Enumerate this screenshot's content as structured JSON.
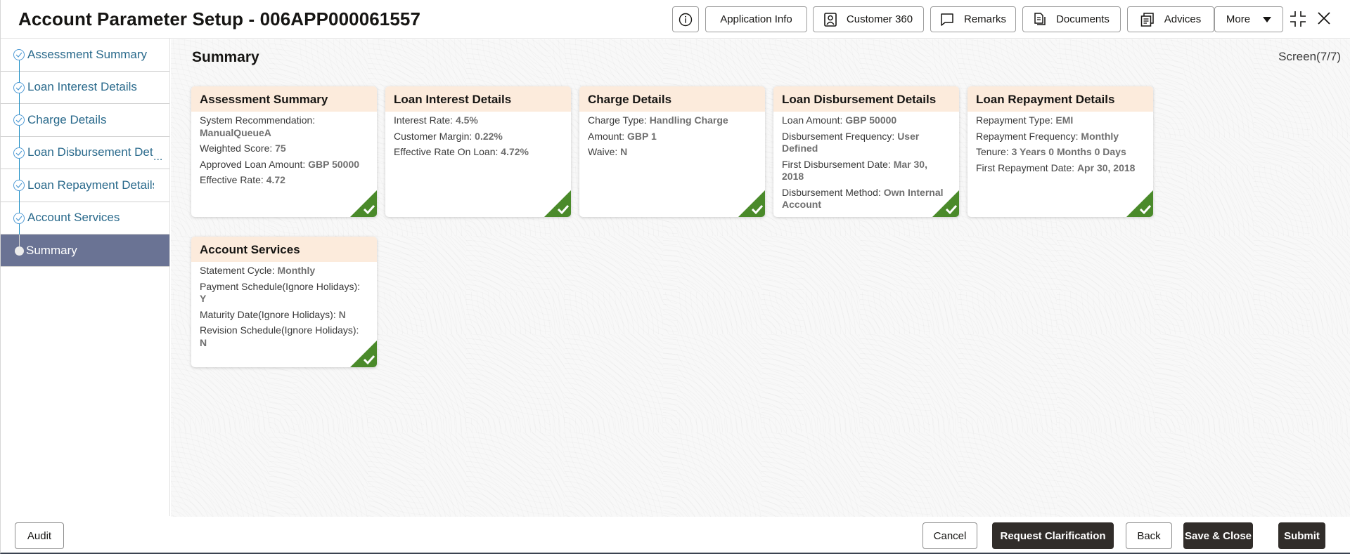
{
  "header": {
    "title": "Account Parameter Setup - 006APP000061557",
    "buttons": {
      "info_icon": "info-icon",
      "application_info": "Application Info",
      "customer_360": "Customer 360",
      "remarks": "Remarks",
      "documents": "Documents",
      "advices": "Advices",
      "more": "More"
    }
  },
  "sidebar": {
    "items": [
      {
        "label": "Assessment Summary",
        "state": "completed"
      },
      {
        "label": "Loan Interest Details",
        "state": "completed"
      },
      {
        "label": "Charge Details",
        "state": "completed"
      },
      {
        "label": "Loan Disbursement Det",
        "state": "completed",
        "truncated_indicator": "..."
      },
      {
        "label": "Loan Repayment Details",
        "state": "completed"
      },
      {
        "label": "Account Services",
        "state": "completed"
      },
      {
        "label": "Summary",
        "state": "active"
      }
    ]
  },
  "main": {
    "title": "Summary",
    "screen_counter": "Screen(7/7)",
    "cards": [
      {
        "title": "Assessment Summary",
        "rows": [
          {
            "label": "System Recommendation: ",
            "value": "ManualQueueA"
          },
          {
            "label": "Weighted Score: ",
            "value": "75"
          },
          {
            "label": "Approved Loan Amount: ",
            "value": "GBP 50000"
          },
          {
            "label": "Effective Rate: ",
            "value": "4.72"
          }
        ],
        "status": "completed"
      },
      {
        "title": "Loan Interest Details",
        "rows": [
          {
            "label": "Interest Rate: ",
            "value": "4.5%"
          },
          {
            "label": "Customer Margin: ",
            "value": "0.22%"
          },
          {
            "label": "Effective Rate On Loan: ",
            "value": "4.72%"
          }
        ],
        "status": "completed"
      },
      {
        "title": "Charge Details",
        "rows": [
          {
            "label": "Charge Type: ",
            "value": "Handling Charge"
          },
          {
            "label": "Amount: ",
            "value": "GBP 1"
          },
          {
            "label": "Waive: ",
            "value": "N"
          }
        ],
        "status": "completed"
      },
      {
        "title": "Loan Disbursement Details",
        "rows": [
          {
            "label": "Loan Amount: ",
            "value": "GBP 50000"
          },
          {
            "label": "Disbursement Frequency: ",
            "value": "User Defined"
          },
          {
            "label": "First Disbursement Date: ",
            "value": "Mar 30, 2018"
          },
          {
            "label": "Disbursement Method: ",
            "value": "Own Internal Account"
          }
        ],
        "status": "completed"
      },
      {
        "title": "Loan Repayment Details",
        "rows": [
          {
            "label": "Repayment Type: ",
            "value": "EMI"
          },
          {
            "label": "Repayment Frequency: ",
            "value": "Monthly"
          },
          {
            "label": "Tenure: ",
            "value": "3 Years 0 Months 0 Days"
          },
          {
            "label": "First Repayment Date: ",
            "value": "Apr 30, 2018"
          }
        ],
        "status": "completed"
      },
      {
        "title": "Account Services",
        "rows": [
          {
            "label": "Statement Cycle: ",
            "value": "Monthly"
          },
          {
            "label": "Payment Schedule(Ignore Holidays): ",
            "value": "Y"
          },
          {
            "label": "Maturity Date(Ignore Holidays): ",
            "value": "N"
          },
          {
            "label": "Revision Schedule(Ignore Holidays): ",
            "value": "N"
          }
        ],
        "status": "completed"
      }
    ]
  },
  "footer": {
    "audit": "Audit",
    "cancel": "Cancel",
    "request_clarification": "Request Clarification",
    "back": "Back",
    "save_close": "Save & Close",
    "submit": "Submit"
  },
  "colors": {
    "sidebar_active_bg": "#6a7394",
    "step_link": "#2a6a8c",
    "card_header_bg": "#fcebdc",
    "completed_tick": "#4a8a2a",
    "primary_button": "#312d2a"
  }
}
